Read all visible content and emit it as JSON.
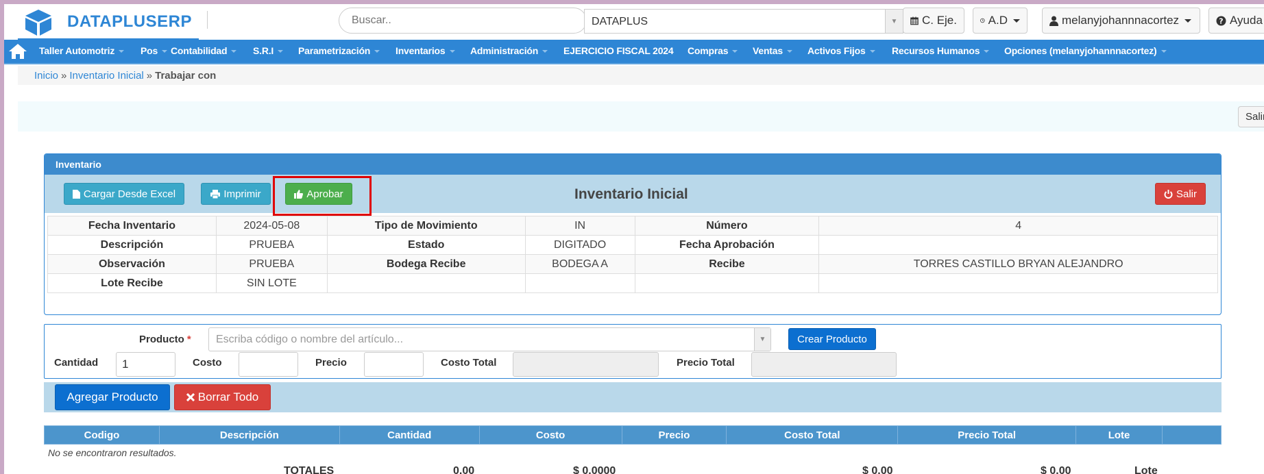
{
  "header": {
    "brand": "DATAPLUSERP",
    "search_placeholder": "Buscar..",
    "company": "DATAPLUS",
    "fiscal_button": "C. Eje.",
    "ad_button": "A.D",
    "user_button": "melanyjohannnacortez",
    "help_button": "Ayuda"
  },
  "nav": {
    "items": [
      {
        "label": "Taller Automotriz"
      },
      {
        "label": "Pos"
      },
      {
        "label": "Contabilidad"
      },
      {
        "label": "S.R.I"
      },
      {
        "label": "Parametrización"
      },
      {
        "label": "Inventarios"
      },
      {
        "label": "Administración"
      },
      {
        "label": "EJERCICIO FISCAL 2024"
      },
      {
        "label": "Compras"
      },
      {
        "label": "Ventas"
      },
      {
        "label": "Activos Fijos"
      },
      {
        "label": "Recursos Humanos"
      },
      {
        "label": "Opciones (melanyjohannnacortez)"
      }
    ]
  },
  "breadcrumb": {
    "home": "Inicio",
    "parent": "Inventario Inicial",
    "current": "Trabajar con"
  },
  "top_exit": "Salir",
  "panel": {
    "heading": "Inventario",
    "title": "Inventario Inicial",
    "buttons": {
      "load_excel": "Cargar Desde Excel",
      "print": "Imprimir",
      "approve": "Aprobar",
      "exit": "Salir"
    },
    "details": {
      "fecha_inventario_label": "Fecha Inventario",
      "fecha_inventario": "2024-05-08",
      "tipo_movimiento_label": "Tipo de Movimiento",
      "tipo_movimiento": "IN",
      "numero_label": "Número",
      "numero": "4",
      "descripcion_label": "Descripción",
      "descripcion": "PRUEBA",
      "estado_label": "Estado",
      "estado": "DIGITADO",
      "fecha_aprobacion_label": "Fecha Aprobación",
      "fecha_aprobacion": "",
      "observacion_label": "Observación",
      "observacion": "PRUEBA",
      "bodega_recibe_label": "Bodega Recibe",
      "bodega_recibe": "BODEGA A",
      "recibe_label": "Recibe",
      "recibe": "TORRES CASTILLO BRYAN ALEJANDRO",
      "lote_recibe_label": "Lote Recibe",
      "lote_recibe": "SIN LOTE"
    }
  },
  "entry": {
    "producto_label": "Producto",
    "required_mark": "*",
    "producto_placeholder": "Escriba código o nombre del artículo...",
    "create_product": "Crear Producto",
    "cantidad_label": "Cantidad",
    "cantidad_value": "1",
    "costo_label": "Costo",
    "costo_value": "",
    "precio_label": "Precio",
    "precio_value": "",
    "costo_total_label": "Costo Total",
    "precio_total_label": "Precio Total"
  },
  "actions": {
    "add_product": "Agregar Producto",
    "clear_all": "Borrar Todo"
  },
  "results": {
    "columns": [
      "Codigo",
      "Descripción",
      "Cantidad",
      "Costo",
      "Precio",
      "Costo Total",
      "Precio Total",
      "Lote",
      ""
    ],
    "empty_message": "No se encontraron resultados.",
    "totals_label": "TOTALES",
    "total_cantidad": "0.00",
    "total_costo": "$ 0.0000",
    "total_costo_total": "$ 0.00",
    "total_precio_total": "$ 0.00",
    "total_lote": "Lote"
  },
  "colors": {
    "primary": "#2e86d5",
    "toolbar": "#b9d8ea",
    "success": "#4cae4c",
    "danger": "#d9413b",
    "highlight": "#e00000"
  }
}
